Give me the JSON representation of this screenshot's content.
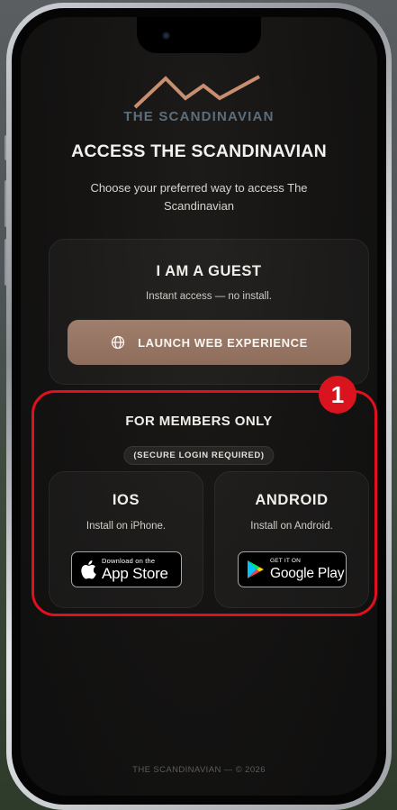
{
  "brand": {
    "logo_text": "THE SCANDINAVIAN",
    "accent_color": "#c98e70"
  },
  "header": {
    "title": "ACCESS THE SCANDINAVIAN",
    "subtitle": "Choose your preferred way to access The Scandinavian"
  },
  "guest": {
    "title": "I AM A GUEST",
    "subtitle": "Instant access — no install.",
    "button_label": "LAUNCH WEB EXPERIENCE",
    "button_icon": "globe-icon"
  },
  "members": {
    "title": "FOR MEMBERS ONLY",
    "badge": "(SECURE LOGIN REQUIRED)",
    "ios": {
      "title": "IOS",
      "subtitle": "Install on iPhone.",
      "badge_small": "Download on the",
      "badge_big": "App Store",
      "icon": "apple-icon"
    },
    "android": {
      "title": "ANDROID",
      "subtitle": "Install on Android.",
      "badge_small": "GET IT ON",
      "badge_big": "Google Play",
      "icon": "google-play-icon"
    }
  },
  "footer": {
    "text": "THE SCANDINAVIAN — © 2026"
  },
  "annotation": {
    "callout_number": "1",
    "color": "#e0101f"
  }
}
